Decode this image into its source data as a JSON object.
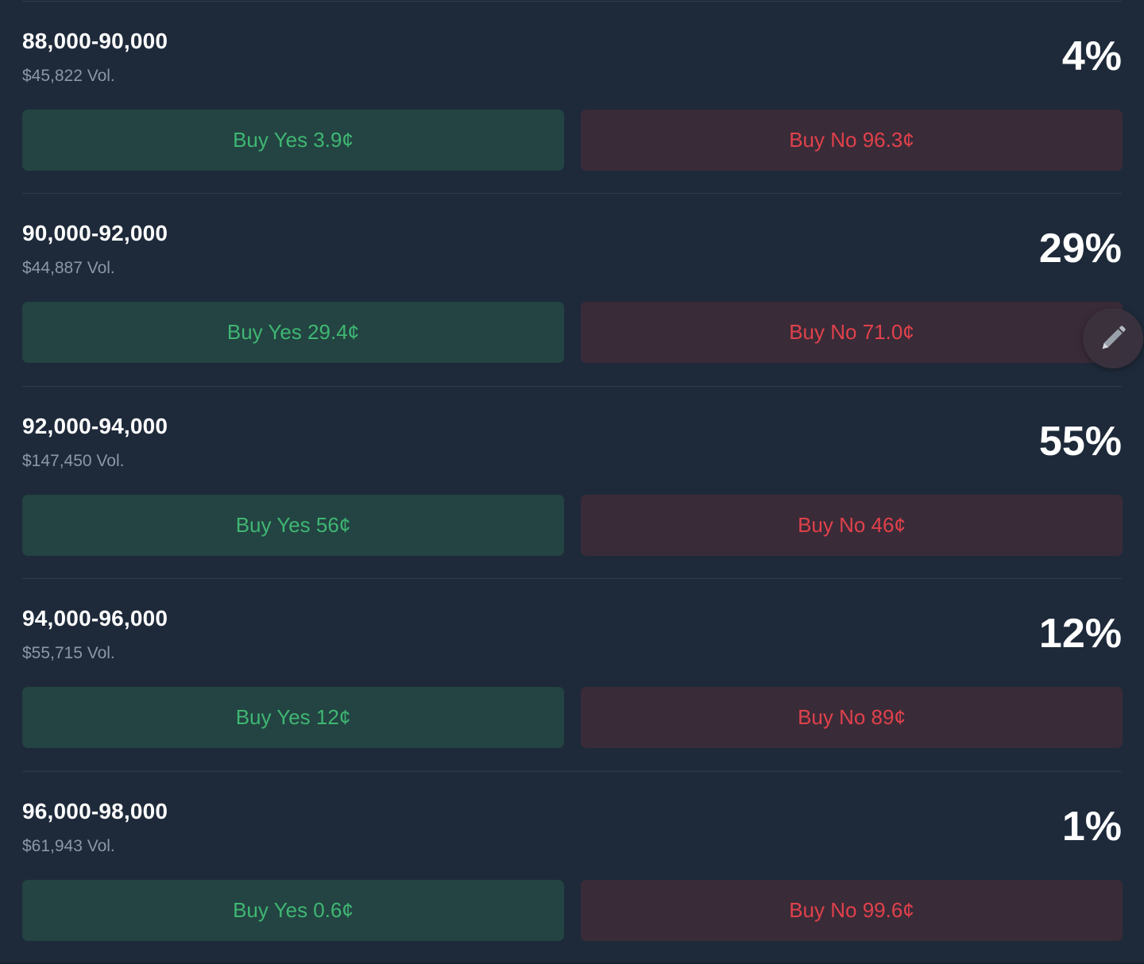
{
  "markets": [
    {
      "range": "88,000-90,000",
      "volume": "$45,822 Vol.",
      "percent": "4%",
      "yes_label": "Buy Yes 3.9¢",
      "no_label": "Buy No 96.3¢"
    },
    {
      "range": "90,000-92,000",
      "volume": "$44,887 Vol.",
      "percent": "29%",
      "yes_label": "Buy Yes 29.4¢",
      "no_label": "Buy No 71.0¢"
    },
    {
      "range": "92,000-94,000",
      "volume": "$147,450 Vol.",
      "percent": "55%",
      "yes_label": "Buy Yes 56¢",
      "no_label": "Buy No 46¢"
    },
    {
      "range": "94,000-96,000",
      "volume": "$55,715 Vol.",
      "percent": "12%",
      "yes_label": "Buy Yes 12¢",
      "no_label": "Buy No 89¢"
    },
    {
      "range": "96,000-98,000",
      "volume": "$61,943 Vol.",
      "percent": "1%",
      "yes_label": "Buy Yes 0.6¢",
      "no_label": "Buy No 99.6¢"
    }
  ],
  "floating_action": {
    "icon": "pencil-icon"
  },
  "colors": {
    "background": "#1e2a3a",
    "yes_bg": "#234442",
    "yes_text": "#3fb673",
    "no_bg": "#3a2b38",
    "no_text": "#e0414b"
  }
}
